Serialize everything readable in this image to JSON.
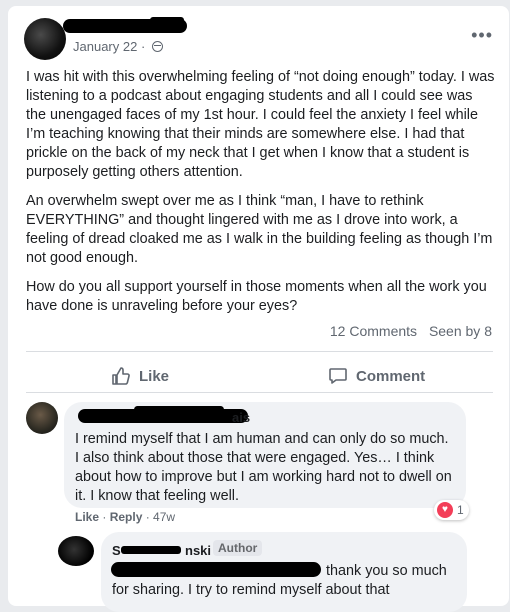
{
  "post": {
    "date": "January 22",
    "paragraphs": [
      "I was hit with this overwhelming feeling of “not doing enough” today. I was listening to a podcast about engaging students and all I could see was the unengaged faces of my 1st hour. I could feel the anxiety I feel while I’m teaching knowing that their minds are somewhere else. I had that prickle on the back of my neck that I get when I know that a student is purposely getting others attention.",
      "An overwhelm swept over me as I think “man, I have to rethink EVERYTHING” and thought lingered with me as I drove into work, a feeling of dread cloaked me as I walk in the building feeling as though I’m not good enough.",
      "How do you all support yourself in those moments when all the work you have done is unraveling before your eyes?"
    ],
    "comments_count": "12 Comments",
    "seen_by": "Seen by 8"
  },
  "actions": {
    "like": "Like",
    "comment": "Comment"
  },
  "comments": [
    {
      "name_visible": "ais",
      "text": "I remind myself that I am human and can only do so much. I also think about those that were engaged. Yes… I think about how to improve but I am working hard not to dwell on it. I know that feeling well.",
      "reaction_count": "1",
      "like": "Like",
      "reply": "Reply",
      "age": "47w"
    },
    {
      "name_visible": "S",
      "name_end": "nski",
      "badge": "Author",
      "text_end": "thank you so much",
      "text_line2": "for sharing. I try to remind myself about that"
    }
  ]
}
